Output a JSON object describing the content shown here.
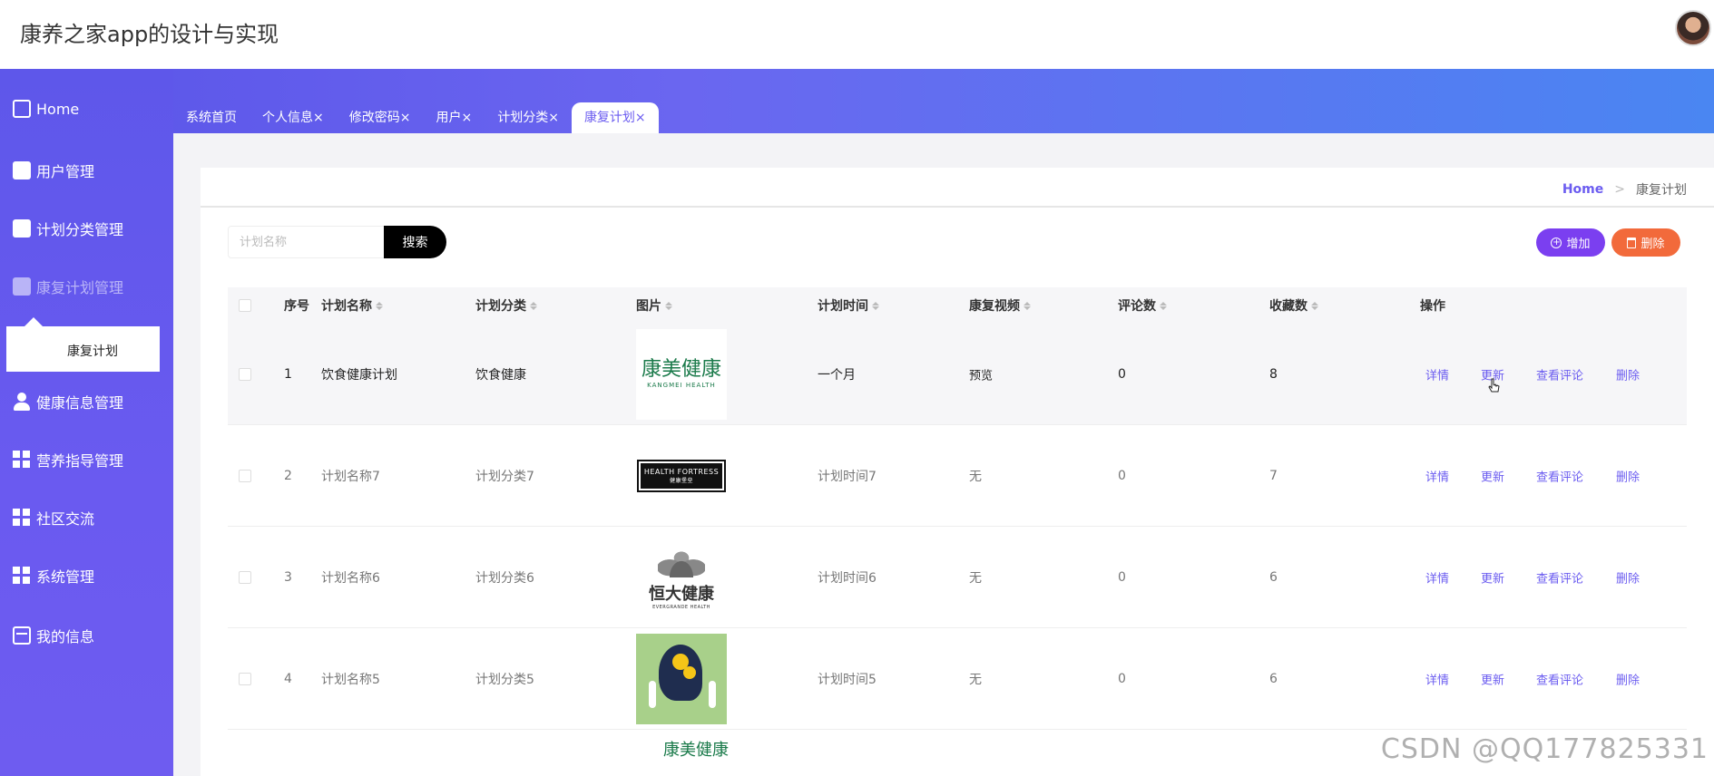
{
  "app": {
    "title": "康养之家app的设计与实现"
  },
  "sidebar": {
    "items": [
      {
        "label": "Home",
        "icon": "home-icon"
      },
      {
        "label": "用户管理",
        "icon": "box-icon"
      },
      {
        "label": "计划分类管理",
        "icon": "clipboard-icon"
      },
      {
        "label": "康复计划管理",
        "icon": "briefcase-icon"
      },
      {
        "label": "健康信息管理",
        "icon": "user-icon"
      },
      {
        "label": "营养指导管理",
        "icon": "grid-icon"
      },
      {
        "label": "社区交流",
        "icon": "grid-icon"
      },
      {
        "label": "系统管理",
        "icon": "grid-icon"
      },
      {
        "label": "我的信息",
        "icon": "card-icon"
      }
    ],
    "submenu": {
      "label": "康复计划"
    }
  },
  "tabs": [
    {
      "label": "系统首页"
    },
    {
      "label": "个人信息×"
    },
    {
      "label": "修改密码×"
    },
    {
      "label": "用户×"
    },
    {
      "label": "计划分类×"
    },
    {
      "label": "康复计划×"
    }
  ],
  "breadcrumb": {
    "home": "Home",
    "sep": ">",
    "current": "康复计划"
  },
  "toolbar": {
    "search_placeholder": "计划名称",
    "search_label": "搜索",
    "add_label": "增加",
    "delete_label": "删除"
  },
  "table": {
    "headers": [
      "序号",
      "计划名称",
      "计划分类",
      "图片",
      "计划时间",
      "康复视频",
      "评论数",
      "收藏数",
      "操作"
    ],
    "actions": [
      "详情",
      "更新",
      "查看评论",
      "删除"
    ],
    "rows": [
      {
        "no": "1",
        "name": "饮食健康计划",
        "category": "饮食健康",
        "image": "logo-kangmei",
        "time": "一个月",
        "video": "预览",
        "comments": "0",
        "favorites": "8"
      },
      {
        "no": "2",
        "name": "计划名称7",
        "category": "计划分类7",
        "image": "logo-health-fortress",
        "time": "计划时间7",
        "video": "无",
        "comments": "0",
        "favorites": "7"
      },
      {
        "no": "3",
        "name": "计划名称6",
        "category": "计划分类6",
        "image": "logo-evergrande",
        "time": "计划时间6",
        "video": "无",
        "comments": "0",
        "favorites": "6"
      },
      {
        "no": "4",
        "name": "计划名称5",
        "category": "计划分类5",
        "image": "logo-brain",
        "time": "计划时间5",
        "video": "无",
        "comments": "0",
        "favorites": "6"
      }
    ]
  },
  "logos": {
    "kangmei": {
      "title": "康美健康",
      "sub": "KANGMEI HEALTH"
    },
    "fortress": {
      "title": "HEALTH FORTRESS",
      "sub": "健康堡垒"
    },
    "evergrande": {
      "title": "恒大健康",
      "sub": "EVERGRANDE HEALTH"
    },
    "partial": "康美健康"
  },
  "colors": {
    "accent": "#6b5cf0",
    "add": "#7b3ff0",
    "delete": "#f26a3b",
    "preview": "#2fb58a"
  },
  "watermark": "CSDN @QQ177825331"
}
